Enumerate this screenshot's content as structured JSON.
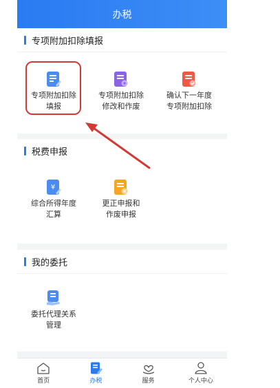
{
  "header": {
    "title": "办税"
  },
  "sections": [
    {
      "title": "专项附加扣除填报",
      "items": [
        {
          "label_line1": "专项附加扣除",
          "label_line2": "填报",
          "icon": "document-edit-icon",
          "color": "#4a8cf0"
        },
        {
          "label_line1": "专项附加扣除",
          "label_line2": "修改和作废",
          "icon": "document-settings-icon",
          "color": "#8a63e6"
        },
        {
          "label_line1": "确认下一年度",
          "label_line2": "专项附加扣除",
          "icon": "document-check-icon",
          "color": "#ef5a46"
        }
      ]
    },
    {
      "title": "税费申报",
      "items": [
        {
          "label_line1": "综合所得年度",
          "label_line2": "汇算",
          "icon": "yuan-document-icon",
          "color": "#4a8cf0"
        },
        {
          "label_line1": "更正申报和",
          "label_line2": "作废申报",
          "icon": "document-cancel-icon",
          "color": "#f5a623"
        }
      ]
    },
    {
      "title": "我的委托",
      "items": [
        {
          "label_line1": "委托代理关系",
          "label_line2": "管理",
          "icon": "document-hand-icon",
          "color": "#4a8cf0"
        }
      ]
    }
  ],
  "tabbar": [
    {
      "label": "首页",
      "icon": "home-icon",
      "active": false
    },
    {
      "label": "办税",
      "icon": "tax-document-icon",
      "active": true
    },
    {
      "label": "服务",
      "icon": "heart-hand-icon",
      "active": false
    },
    {
      "label": "个人中心",
      "icon": "person-icon",
      "active": false
    }
  ],
  "colors": {
    "accent": "#2a7af2",
    "highlight": "#d23a35"
  }
}
